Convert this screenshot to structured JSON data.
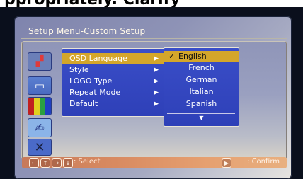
{
  "page_header_text": "ppropriately. Clarify",
  "screen": {
    "title": "Setup Menu-Custom Setup"
  },
  "side_icons": [
    "display-settings-icon",
    "tv-screen-icon",
    "color-bars-icon",
    "custom-setup-icon",
    "exit-icon"
  ],
  "menu": {
    "items": [
      {
        "label": "OSD Language",
        "arrow": "▶"
      },
      {
        "label": "Style",
        "arrow": "▶"
      },
      {
        "label": "LOGO Type",
        "arrow": "▶"
      },
      {
        "label": "Repeat Mode",
        "arrow": "▶"
      },
      {
        "label": "Default",
        "arrow": "▶"
      }
    ]
  },
  "submenu": {
    "check": "✓",
    "items": [
      {
        "label": "English"
      },
      {
        "label": "French"
      },
      {
        "label": "German"
      },
      {
        "label": "Italian"
      },
      {
        "label": "Spanish"
      }
    ],
    "more_indicator": "▼"
  },
  "footer": {
    "nav_keys": [
      "←",
      "↑",
      "→",
      "↓"
    ],
    "select_text": ": Select",
    "ok_key": "▶",
    "confirm_text": ": Confirm"
  },
  "colors": {
    "menu_bg": "#2e40b8",
    "highlight": "#d4a62a",
    "footer": "#d88a60"
  }
}
